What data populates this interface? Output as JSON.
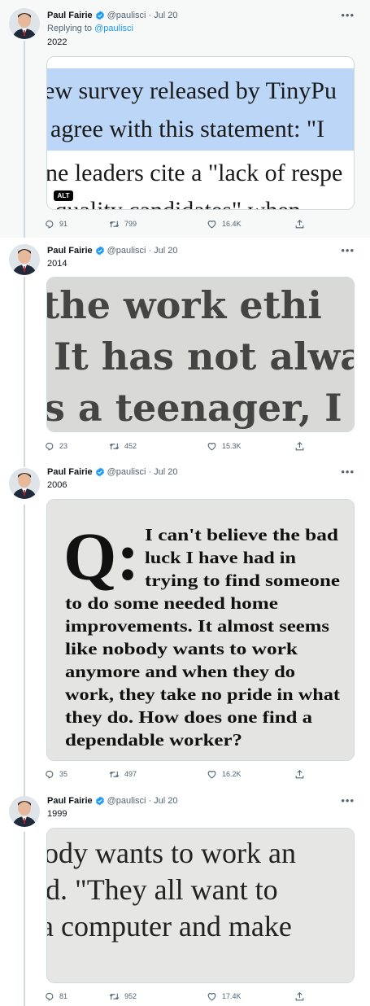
{
  "tweets": [
    {
      "author": "Paul Fairie",
      "handle": "@paulisci",
      "separator": "·",
      "time": "Jul 20",
      "replying_label": "Replying to",
      "replying_to": "@paulisci",
      "text": "2022",
      "media_text": [
        "ew survey released by TinyPu",
        "agree with this statement: \"I",
        "ne leaders cite a \"lack of respe",
        "r quality candidates\" when"
      ],
      "alt_label": "ALT",
      "replies": "91",
      "retweets": "799",
      "likes": "16.4K"
    },
    {
      "author": "Paul Fairie",
      "handle": "@paulisci",
      "separator": "·",
      "time": "Jul 20",
      "text": "2014",
      "media_text": [
        "the work ethi",
        "It has not alwa",
        "s a teenager, I"
      ],
      "replies": "23",
      "retweets": "452",
      "likes": "15.3K"
    },
    {
      "author": "Paul Fairie",
      "handle": "@paulisci",
      "separator": "·",
      "time": "Jul 20",
      "text": "2006",
      "media_q": "Q:",
      "media_text": [
        "I can't believe the bad",
        "luck I have had in",
        "trying to find someone",
        "to do some needed home",
        "improvements. It almost seems",
        "like nobody wants to work",
        "anymore and when they do",
        "work, they take no pride in what",
        "they do. How does one find a",
        "dependable worker?"
      ],
      "replies": "35",
      "retweets": "497",
      "likes": "16.2K"
    },
    {
      "author": "Paul Fairie",
      "handle": "@paulisci",
      "separator": "·",
      "time": "Jul 20",
      "text": "1999",
      "media_text": [
        "ody wants to work an",
        "d. \"They all want to",
        "a computer and make"
      ],
      "replies": "81",
      "retweets": "952",
      "likes": "17.4K"
    }
  ],
  "more_icon": "more-horizontal-icon",
  "colors": {
    "accent": "#1d9bf0",
    "muted": "#536471",
    "border": "#cfd9de",
    "highlight": "#bcd6f7"
  }
}
